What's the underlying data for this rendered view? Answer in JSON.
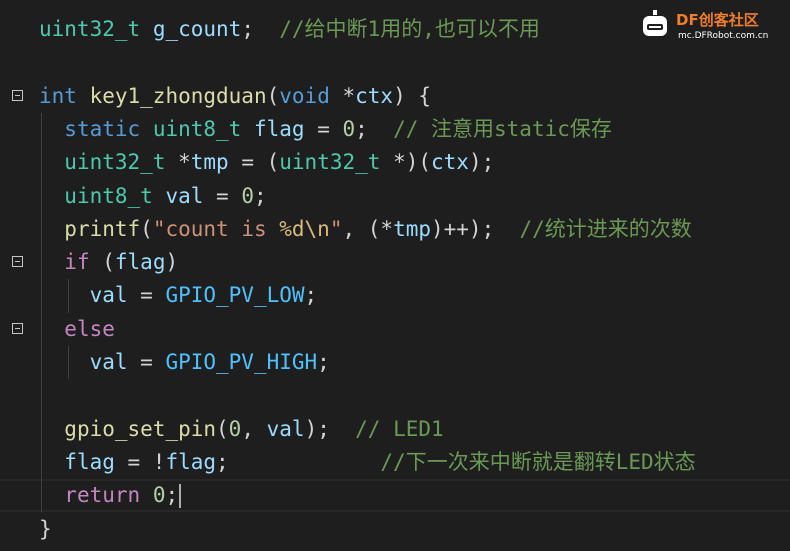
{
  "editor": {
    "lines": [
      [
        {
          "t": "uint32_t",
          "c": "ty"
        },
        {
          "t": " "
        },
        {
          "t": "g_count",
          "c": "vr"
        },
        {
          "t": ";  "
        },
        {
          "t": "//给中断1用的,也可以不用",
          "c": "co"
        }
      ],
      [],
      [
        {
          "t": "int",
          "c": "kw"
        },
        {
          "t": " "
        },
        {
          "t": "key1_zhongduan",
          "c": "fn"
        },
        {
          "t": "("
        },
        {
          "t": "void",
          "c": "kw"
        },
        {
          "t": " *"
        },
        {
          "t": "ctx",
          "c": "vr"
        },
        {
          "t": ") {"
        }
      ],
      [
        {
          "t": "  "
        },
        {
          "t": "static",
          "c": "kw"
        },
        {
          "t": " "
        },
        {
          "t": "uint8_t",
          "c": "ty"
        },
        {
          "t": " "
        },
        {
          "t": "flag",
          "c": "vr"
        },
        {
          "t": " = "
        },
        {
          "t": "0",
          "c": "nu"
        },
        {
          "t": ";  "
        },
        {
          "t": "// 注意用static保存",
          "c": "co"
        }
      ],
      [
        {
          "t": "  "
        },
        {
          "t": "uint32_t",
          "c": "ty"
        },
        {
          "t": " *"
        },
        {
          "t": "tmp",
          "c": "vr"
        },
        {
          "t": " = ("
        },
        {
          "t": "uint32_t",
          "c": "ty"
        },
        {
          "t": " *)("
        },
        {
          "t": "ctx",
          "c": "vr"
        },
        {
          "t": ");"
        }
      ],
      [
        {
          "t": "  "
        },
        {
          "t": "uint8_t",
          "c": "ty"
        },
        {
          "t": " "
        },
        {
          "t": "val",
          "c": "vr"
        },
        {
          "t": " = "
        },
        {
          "t": "0",
          "c": "nu"
        },
        {
          "t": ";"
        }
      ],
      [
        {
          "t": "  "
        },
        {
          "t": "printf",
          "c": "fn"
        },
        {
          "t": "("
        },
        {
          "t": "\"count is ",
          "c": "st"
        },
        {
          "t": "%d\\n",
          "c": "esc"
        },
        {
          "t": "\"",
          "c": "st"
        },
        {
          "t": ", (*"
        },
        {
          "t": "tmp",
          "c": "vr"
        },
        {
          "t": ")++);  "
        },
        {
          "t": "//统计进来的次数",
          "c": "co"
        }
      ],
      [
        {
          "t": "  "
        },
        {
          "t": "if",
          "c": "cl"
        },
        {
          "t": " ("
        },
        {
          "t": "flag",
          "c": "vr"
        },
        {
          "t": ")"
        }
      ],
      [
        {
          "t": "    "
        },
        {
          "t": "val",
          "c": "vr"
        },
        {
          "t": " = "
        },
        {
          "t": "GPIO_PV_LOW",
          "c": "mc"
        },
        {
          "t": ";"
        }
      ],
      [
        {
          "t": "  "
        },
        {
          "t": "else",
          "c": "cl"
        }
      ],
      [
        {
          "t": "    "
        },
        {
          "t": "val",
          "c": "vr"
        },
        {
          "t": " = "
        },
        {
          "t": "GPIO_PV_HIGH",
          "c": "mc"
        },
        {
          "t": ";"
        }
      ],
      [],
      [
        {
          "t": "  "
        },
        {
          "t": "gpio_set_pin",
          "c": "fn"
        },
        {
          "t": "("
        },
        {
          "t": "0",
          "c": "nu"
        },
        {
          "t": ", "
        },
        {
          "t": "val",
          "c": "vr"
        },
        {
          "t": ");  "
        },
        {
          "t": "// LED1",
          "c": "co"
        }
      ],
      [
        {
          "t": "  "
        },
        {
          "t": "flag",
          "c": "vr"
        },
        {
          "t": " = !"
        },
        {
          "t": "flag",
          "c": "vr"
        },
        {
          "t": ";            "
        },
        {
          "t": "//下一次来中断就是翻转LED状态",
          "c": "co"
        }
      ],
      [
        {
          "t": "  "
        },
        {
          "t": "return",
          "c": "cl"
        },
        {
          "t": " "
        },
        {
          "t": "0",
          "c": "nu"
        },
        {
          "t": ";"
        }
      ],
      [
        {
          "t": "}"
        }
      ]
    ],
    "fold_lines": [
      2,
      7,
      9
    ],
    "current_line": 14
  },
  "watermark": {
    "title": "DF创客社区",
    "subtitle": "mc.DFRobot.com.cn"
  }
}
